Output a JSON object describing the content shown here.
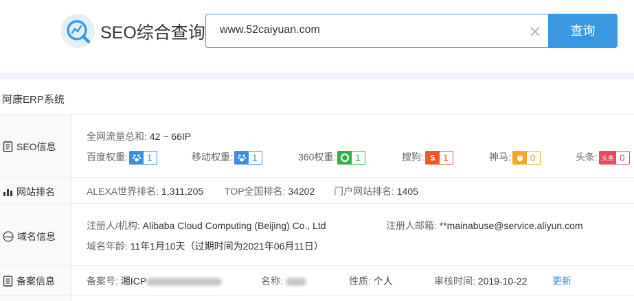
{
  "header": {
    "brand": "SEO综合查询",
    "search_value": "www.52caiyuan.com",
    "search_button": "查询"
  },
  "site_title": "阿康ERP系统",
  "seo": {
    "label": "SEO信息",
    "traffic_label": "全网流量总和:",
    "traffic_value": "42 ~ 66IP",
    "weights": [
      {
        "label": "百度权重:",
        "value": "1",
        "color": "#3a8ee6",
        "icon": "paw-icon"
      },
      {
        "label": "移动权重:",
        "value": "1",
        "color": "#3a8ee6",
        "icon": "paw-icon"
      },
      {
        "label": "360权重:",
        "value": "1",
        "color": "#2db24b",
        "icon": "360-icon"
      },
      {
        "label": "搜狗:",
        "value": "1",
        "color": "#f05a28",
        "icon": "sogou-icon"
      },
      {
        "label": "神马:",
        "value": "0",
        "color": "#f5a623",
        "icon": "shenma-icon"
      },
      {
        "label": "头条:",
        "value": "0",
        "color": "#e84a5f",
        "icon": "toutiao-icon",
        "icon_text": "头条"
      }
    ]
  },
  "rank": {
    "label": "网站排名",
    "alexa_label": "ALEXA世界排名:",
    "alexa_value": "1,311,205",
    "top_label": "TOP全国排名:",
    "top_value": "34202",
    "portal_label": "门户网站排名:",
    "portal_value": "1405"
  },
  "domain": {
    "label": "域名信息",
    "registrant_label": "注册人/机构:",
    "registrant_value": "Alibaba Cloud Computing (Beijing) Co., Ltd",
    "email_label": "注册人邮箱:",
    "email_value": "**mainabuse@service.aliyun.com",
    "age_label": "域名年龄:",
    "age_value": "11年1月10天（过期时间为2021年06月11日）"
  },
  "icp": {
    "label": "备案信息",
    "number_label": "备案号:",
    "number_value": "湘ICP",
    "name_label": "名称:",
    "type_label": "性质:",
    "type_value": "个人",
    "audit_label": "审核时间:",
    "audit_value": "2019-10-22",
    "update_link": "更新"
  }
}
